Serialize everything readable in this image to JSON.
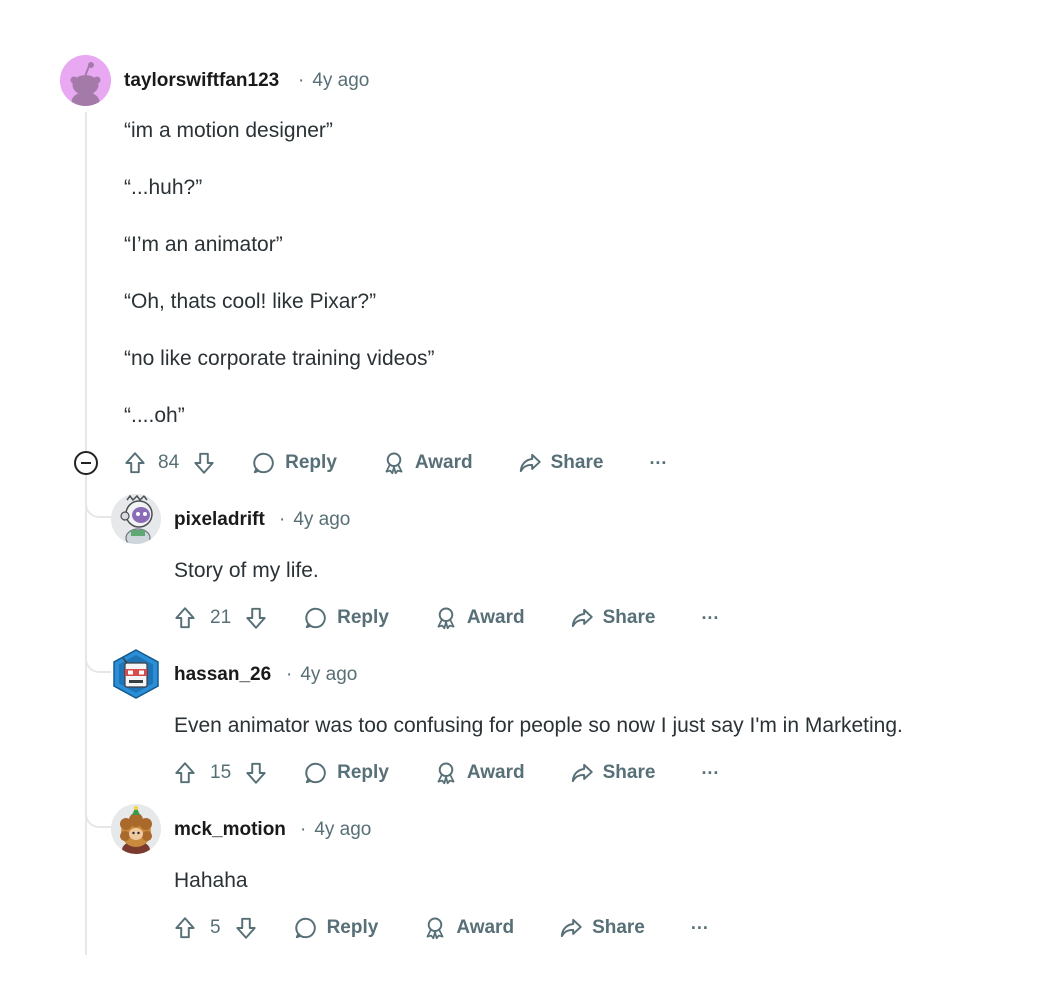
{
  "comments": [
    {
      "username": "taylorswiftfan123",
      "time": "4y ago",
      "body": [
        "“im a motion designer”",
        "“...huh?”",
        "“I’m an animator”",
        "“Oh, thats cool! like Pixar?”",
        "“no like corporate training videos”",
        "“....oh”"
      ],
      "votes": "84",
      "avatar_icon": "snoo-avatar-icon",
      "avatar_color": "#e9a9f2"
    },
    {
      "username": "pixeladrift",
      "time": "4y ago",
      "body": [
        "Story of my life."
      ],
      "votes": "21",
      "avatar_icon": "astronaut-avatar-icon"
    },
    {
      "username": "hassan_26",
      "time": "4y ago",
      "body": [
        "Even animator was too confusing for people so now I just say I'm in Marketing."
      ],
      "votes": "15",
      "avatar_icon": "robot-avatar-icon",
      "avatar_color": "#2a8fd6"
    },
    {
      "username": "mck_motion",
      "time": "4y ago",
      "body": [
        "Hahaha"
      ],
      "votes": "5",
      "avatar_icon": "curly-hair-avatar-icon"
    }
  ],
  "actions": {
    "reply": "Reply",
    "award": "Award",
    "share": "Share",
    "more": "···"
  },
  "separator": "·",
  "colors": {
    "meta_text": "#576f76",
    "thread_line": "#e5e7e9"
  }
}
